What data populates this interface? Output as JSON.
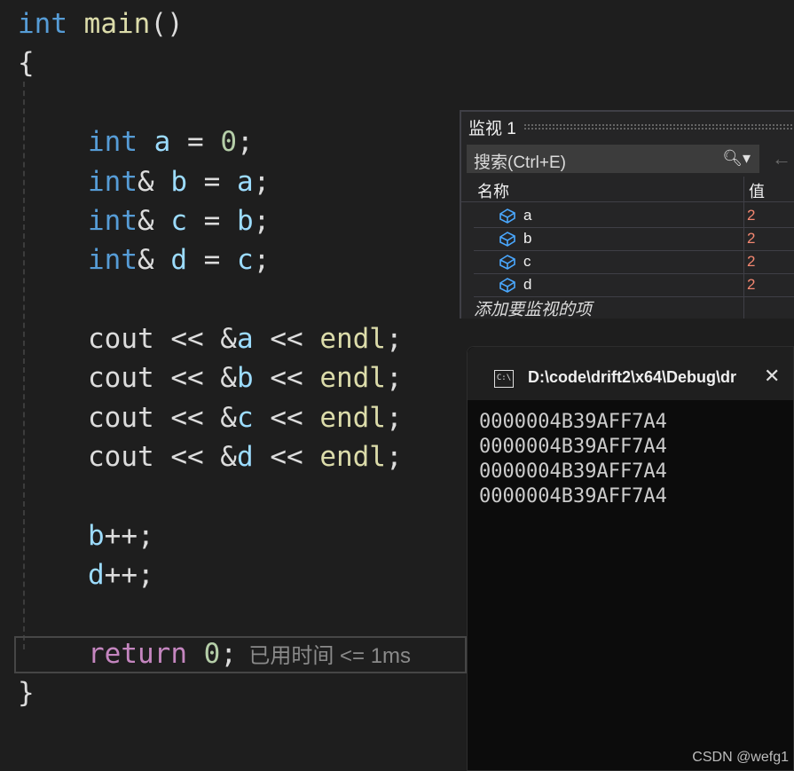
{
  "code": {
    "l1": {
      "kw": "int",
      "sp": " ",
      "fn": "main",
      "pl": "()"
    },
    "l2": "{",
    "l3": {
      "kw": "int",
      "v": " a",
      "eq": " = ",
      "num": "0",
      "end": ";"
    },
    "l4": {
      "kw": "int",
      "amp": "& ",
      "v": "b",
      "eq": " = ",
      "v2": "a",
      "end": ";"
    },
    "l5": {
      "kw": "int",
      "amp": "& ",
      "v": "c",
      "eq": " = ",
      "v2": "b",
      "end": ";"
    },
    "l6": {
      "kw": "int",
      "amp": "& ",
      "v": "d",
      "eq": " = ",
      "v2": "c",
      "end": ";"
    },
    "c1": {
      "a": "cout",
      " b": " << &",
      "v": "a",
      "c": " << ",
      "fn": "endl",
      "e": ";"
    },
    "c2": {
      "a": "cout",
      " b": " << &",
      "v": "b",
      "c": " << ",
      "fn": "endl",
      "e": ";"
    },
    "c3": {
      "a": "cout",
      " b": " << &",
      "v": "c",
      "c": " << ",
      "fn": "endl",
      "e": ";"
    },
    "c4": {
      "a": "cout",
      " b": " << &",
      "v": "d",
      "c": " << ",
      "fn": "endl",
      "e": ";"
    },
    "inc1": {
      "v": "b",
      "op": "++;"
    },
    "inc2": {
      "v": "d",
      "op": "++;"
    },
    "ret": {
      "kw": "return",
      "sp": " ",
      "num": "0",
      "end": ";",
      "perf": "已用时间 <= 1ms"
    },
    "close": "}"
  },
  "watch": {
    "title": "监视 1",
    "search_placeholder": "搜索(Ctrl+E)",
    "col_name": "名称",
    "col_value": "值",
    "rows": [
      {
        "name": "a",
        "value": "2"
      },
      {
        "name": "b",
        "value": "2"
      },
      {
        "name": "c",
        "value": "2"
      },
      {
        "name": "d",
        "value": "2"
      }
    ],
    "add_item": "添加要监视的项"
  },
  "console": {
    "title": "D:\\code\\drift2\\x64\\Debug\\dr",
    "icon_text": "C:\\",
    "lines": [
      "0000004B39AFF7A4",
      "0000004B39AFF7A4",
      "0000004B39AFF7A4",
      "0000004B39AFF7A4"
    ]
  },
  "watermark": "CSDN @wefg1"
}
